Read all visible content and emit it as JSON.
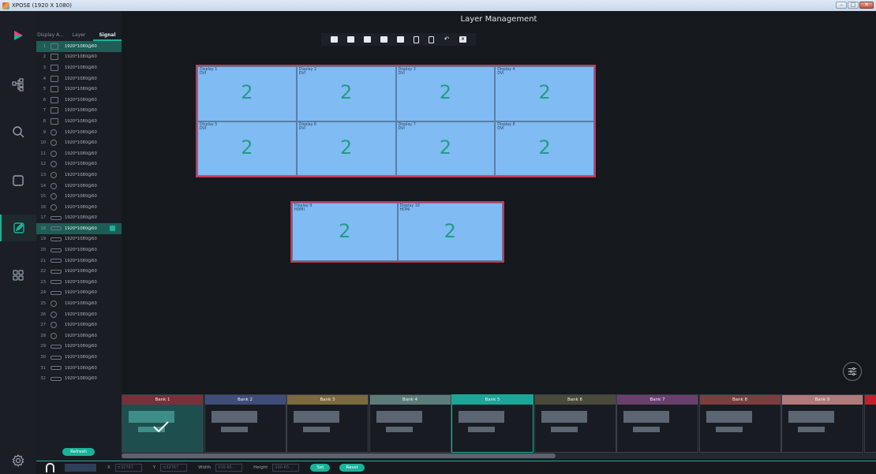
{
  "window": {
    "title": "XPOSE (1920 X 1080)",
    "controls": [
      "–",
      "□",
      "✕"
    ]
  },
  "page": {
    "title": "Layer Management"
  },
  "nav": [
    "logo-icon",
    "topology-icon",
    "search-icon",
    "screen-icon",
    "edit-icon",
    "grid-icon",
    "settings-icon"
  ],
  "signal_panel": {
    "tabs": [
      "Display A...",
      "Layer",
      "Signal"
    ],
    "active_tab": "Signal",
    "rows": [
      {
        "num": "1",
        "res": "1920*1080@60"
      },
      {
        "num": "2",
        "res": "1920*1080@60"
      },
      {
        "num": "3",
        "res": "1920*1080@60"
      },
      {
        "num": "4",
        "res": "1920*1080@60"
      },
      {
        "num": "5",
        "res": "1920*1080@60"
      },
      {
        "num": "6",
        "res": "1920*1080@60"
      },
      {
        "num": "7",
        "res": "1920*1080@60"
      },
      {
        "num": "8",
        "res": "1920*1080@60"
      },
      {
        "num": "9",
        "res": "1920*1080@60"
      },
      {
        "num": "10",
        "res": "1920*1080@60"
      },
      {
        "num": "11",
        "res": "1920*1080@60"
      },
      {
        "num": "12",
        "res": "1920*1080@60"
      },
      {
        "num": "13",
        "res": "1920*1080@60"
      },
      {
        "num": "14",
        "res": "1920*1080@60"
      },
      {
        "num": "15",
        "res": "1920*1080@60"
      },
      {
        "num": "16",
        "res": "1920*1080@60"
      },
      {
        "num": "17",
        "res": "1920*1080@60"
      },
      {
        "num": "18",
        "res": "1920*1080@60"
      },
      {
        "num": "19",
        "res": "1920*1080@60"
      },
      {
        "num": "20",
        "res": "1920*1080@60"
      },
      {
        "num": "21",
        "res": "1920*1080@60"
      },
      {
        "num": "22",
        "res": "1920*1080@60"
      },
      {
        "num": "23",
        "res": "1920*1080@60"
      },
      {
        "num": "24",
        "res": "1920*1080@60"
      },
      {
        "num": "25",
        "res": "1920*1080@60"
      },
      {
        "num": "26",
        "res": "1920*1080@60"
      },
      {
        "num": "27",
        "res": "1920*1080@60"
      },
      {
        "num": "28",
        "res": "1920*1080@60"
      },
      {
        "num": "29",
        "res": "1920*1080@60"
      },
      {
        "num": "30",
        "res": "1920*1080@60"
      },
      {
        "num": "31",
        "res": "1920*1080@60"
      },
      {
        "num": "32",
        "res": "1920*1080@60"
      }
    ],
    "refresh_label": "Refresh"
  },
  "toolbar": [
    "layer-front-icon",
    "layer-back-icon",
    "layer-up-icon",
    "layer-down-icon",
    "layer-fill-icon",
    "copy-icon",
    "paste-icon",
    "undo-icon",
    "clear-icon"
  ],
  "walls": [
    {
      "screens": [
        {
          "name": "Display 1",
          "src": "DVI",
          "layer": "2"
        },
        {
          "name": "Display 2",
          "src": "DVI",
          "layer": "2"
        },
        {
          "name": "Display 3",
          "src": "DVI",
          "layer": "2"
        },
        {
          "name": "Display 4",
          "src": "DVI",
          "layer": "2"
        },
        {
          "name": "Display 5",
          "src": "DVI",
          "layer": "2"
        },
        {
          "name": "Display 6",
          "src": "DVI",
          "layer": "2"
        },
        {
          "name": "Display 7",
          "src": "DVI",
          "layer": "2"
        },
        {
          "name": "Display 8",
          "src": "DVI",
          "layer": "2"
        }
      ]
    },
    {
      "screens": [
        {
          "name": "Display 9",
          "src": "HDMI",
          "layer": "2"
        },
        {
          "name": "Display 10",
          "src": "HDMI",
          "layer": "2"
        }
      ]
    }
  ],
  "banks": [
    {
      "label": "Bank 1",
      "color": "#7a2f3a"
    },
    {
      "label": "Bank 2",
      "color": "#3e4d7a"
    },
    {
      "label": "Bank 3",
      "color": "#7a6a3e"
    },
    {
      "label": "Bank 4",
      "color": "#5c7c7a"
    },
    {
      "label": "Bank 5",
      "color": "#19a79a"
    },
    {
      "label": "Bank 6",
      "color": "#4a4a3a"
    },
    {
      "label": "Bank 7",
      "color": "#6a3f6e"
    },
    {
      "label": "Bank 8",
      "color": "#7a3e3e"
    },
    {
      "label": "Bank 9",
      "color": "#b07a7a"
    }
  ],
  "bottom": {
    "x_label": "X",
    "x_placeholder": "±32767",
    "y_label": "Y",
    "y_placeholder": "±32767",
    "width_label": "Width",
    "width_placeholder": "100-65...",
    "height_label": "Height",
    "height_placeholder": "100-65...",
    "set_label": "Set",
    "reset_label": "Reset"
  },
  "colors": {
    "accent": "#19b39a",
    "screen": "#80bbf3",
    "wall_border": "#c2385a"
  }
}
